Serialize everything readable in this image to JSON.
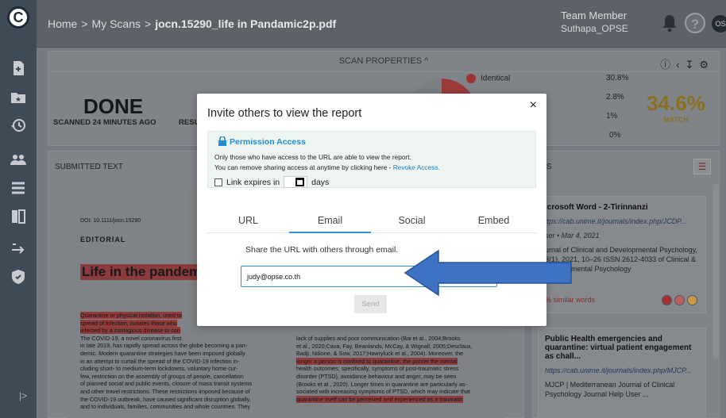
{
  "logo": {
    "letter": "C"
  },
  "breadcrumb": {
    "home": "Home",
    "sep1": ">",
    "scans": "My Scans",
    "sep2": ">",
    "file": "jocn.15290_life in Pandamic2p.pdf"
  },
  "user": {
    "role": "Team Member",
    "name": "Suthapa_OPSE",
    "initials": "OS"
  },
  "help_label": "?",
  "properties": {
    "header": "SCAN PROPERTIES ^",
    "status": "DONE",
    "scanned": "SCANNED 24 MINUTES AGO",
    "resu": "RESU",
    "legend": [
      {
        "label": "Identical",
        "value": "30.8%"
      },
      {
        "label": "",
        "value": "2.8%"
      },
      {
        "label": "",
        "value": "1%"
      },
      {
        "label": "",
        "value": "0%"
      }
    ],
    "match_value": "34.6%",
    "match_label": "MATCH"
  },
  "submitted": {
    "header": "SUBMITTED TEXT",
    "doi": "DOI: 10.1111/jocn.15290",
    "editorial": "EDITORIAL",
    "title": "Life in the pandem",
    "left_col": [
      {
        "t": "Quarantine or physical isolation, used to",
        "h": true
      },
      {
        "t": "spread of infection, isolates those who",
        "h": true
      },
      {
        "t": "infected by a contagious disease to con",
        "h": true
      },
      {
        "t": "The COVID-19, a novel coronavirus first",
        "h": false
      },
      {
        "t": "in late 2019, has rapidly spread across the globe becoming a pan-",
        "h": false
      },
      {
        "t": "demic. Modern quarantine strategies have been imposed globally",
        "h": false
      },
      {
        "t": "in an attempt to curtail the spread of the COVID-19 infection in-",
        "h": false
      },
      {
        "t": "cluding short- to medium-term lockdowns, voluntary home cur-",
        "h": false
      },
      {
        "t": "few, restriction on the assembly of groups of people, cancellation",
        "h": false
      },
      {
        "t": "of planned social and public events, closure of mass transit systems",
        "h": false
      },
      {
        "t": "and other travel restrictions. These restrictions imposed because of",
        "h": false
      },
      {
        "t": "the COVID-19 outbreak, have caused significant disruption globally,",
        "h": false
      },
      {
        "t": "and to individuals, families, communities and whole countries. They",
        "h": false
      }
    ],
    "right_col": [
      {
        "t": "lack of supplies and poor communication (Bai et al., 2004;Brooks",
        "h": false
      },
      {
        "t": "et al., 2020;Cava, Fay, Beanlands, McCay, & Wignall, 2005;Desclaux,",
        "h": false
      },
      {
        "t": "Badji, Ndione, & Sow, 2017;Hawryluck et al., 2004). Moreover, the",
        "h": false
      },
      {
        "t": "longer a person is confined to quarantine, the poorer the mental",
        "h": true
      },
      {
        "t": "health outcomes; specifically, symptoms of post-traumatic stress",
        "h": false
      },
      {
        "t": "disorder (PTSD), avoidance behaviour and anger, may be seen",
        "h": false
      },
      {
        "t": "(Brooks et al., 2020). Longer times in quarantine are particularly as-",
        "h": false
      },
      {
        "t": "sociated with increasing symptoms of PTSD, which may indicate that",
        "h": false
      },
      {
        "t": "quarantine itself can be perceived and experienced as a traumatic",
        "h": true
      }
    ]
  },
  "results": {
    "header": "LTS",
    "filter_icon": "filter-icon",
    "card1": {
      "title": "icrosoft Word - 2-Tirinnanzi",
      "url": "ttps://cab.unime.it/journals/index.php/JCDP...",
      "meta": "ser • Mar 4, 2021",
      "desc": "urnal of Clinical and Developmental Psychology, 3(1), 2021, 10–26 ISSN 2612-4033 of Clinical & Developmental Psychology",
      "similar": "% similar words"
    },
    "card2": {
      "title": "Public Health emergencies and quarantine: virtual patient engagement as chall...",
      "url": "https://cab.unime.it/journals/index.php/MJCP...",
      "desc": "MJCP | Mediterranean Journal of Clinical Psychology Journal Help User ..."
    }
  },
  "sidebar_collapse": "|>",
  "modal": {
    "title": "Invite others to view the report",
    "close": "×",
    "permission_header": "Permission Access",
    "perm_line1": "Only those who have access to the URL are able to view the report.",
    "perm_line2": "You can remove sharing access at anytime by clicking here - ",
    "revoke": "Revoke Access.",
    "expires_label": "Link expires in",
    "days_label": "days",
    "tabs": [
      "URL",
      "Email",
      "Social",
      "Embed"
    ],
    "active_tab": "Email",
    "share_text": "Share the URL with others through email.",
    "email_value": "judy@opse.co.th",
    "send_label": "Send"
  },
  "colors": {
    "accent": "#1f8fcf",
    "arrow": "#3e72c3",
    "match": "#d4a82c",
    "highlight": "#c94848"
  }
}
